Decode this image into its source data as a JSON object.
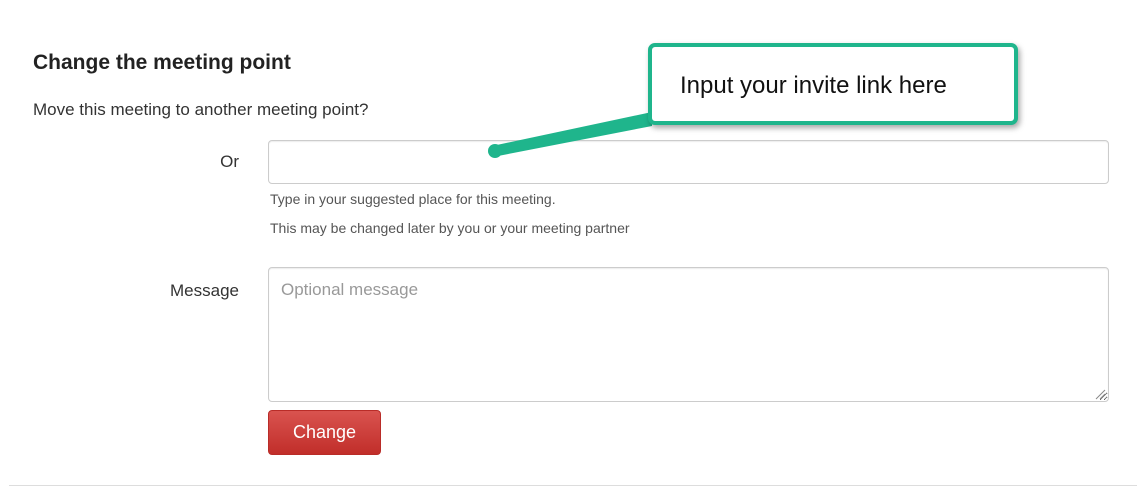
{
  "form": {
    "title": "Change the meeting point",
    "subtitle": "Move this meeting to another meeting point?",
    "or_label": "Or",
    "place_value": "",
    "place_help_1": "Type in your suggested place for this meeting.",
    "place_help_2": "This may be changed later by you or your meeting partner",
    "message_label": "Message",
    "message_placeholder": "Optional message",
    "submit_label": "Change"
  },
  "callout": {
    "text": "Input your invite link here",
    "color": "#1fb58c"
  },
  "colors": {
    "button": "#d9534f",
    "border": "#cccccc"
  }
}
